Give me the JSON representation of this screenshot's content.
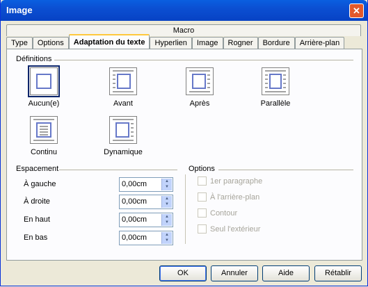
{
  "window": {
    "title": "Image"
  },
  "tabs_top": [
    {
      "label": "Macro"
    }
  ],
  "tabs": [
    {
      "label": "Type"
    },
    {
      "label": "Options"
    },
    {
      "label": "Adaptation du texte"
    },
    {
      "label": "Hyperlien"
    },
    {
      "label": "Image"
    },
    {
      "label": "Rogner"
    },
    {
      "label": "Bordure"
    },
    {
      "label": "Arrière-plan"
    }
  ],
  "definitions": {
    "heading": "Définitions",
    "options": [
      {
        "label": "Aucun(e)"
      },
      {
        "label": "Avant"
      },
      {
        "label": "Après"
      },
      {
        "label": "Parallèle"
      },
      {
        "label": "Continu"
      },
      {
        "label": "Dynamique"
      }
    ],
    "selected": "Aucun(e)"
  },
  "spacing": {
    "heading": "Espacement",
    "rows": [
      {
        "label": "À gauche",
        "value": "0,00cm"
      },
      {
        "label": "À droite",
        "value": "0,00cm"
      },
      {
        "label": "En haut",
        "value": "0,00cm"
      },
      {
        "label": "En bas",
        "value": "0,00cm"
      }
    ]
  },
  "options": {
    "heading": "Options",
    "items": [
      {
        "label": "1er paragraphe",
        "checked": false,
        "enabled": false
      },
      {
        "label": "À l'arrière-plan",
        "checked": false,
        "enabled": false
      },
      {
        "label": "Contour",
        "checked": false,
        "enabled": false
      },
      {
        "label": "Seul l'extérieur",
        "checked": false,
        "enabled": false
      }
    ]
  },
  "buttons": {
    "ok": "OK",
    "cancel": "Annuler",
    "help": "Aide",
    "reset": "Rétablir"
  },
  "colors": {
    "titlebar": "#0a5fe0",
    "accent": "#ffc83c",
    "panel": "#fcfcfe",
    "face": "#ece9d8"
  }
}
